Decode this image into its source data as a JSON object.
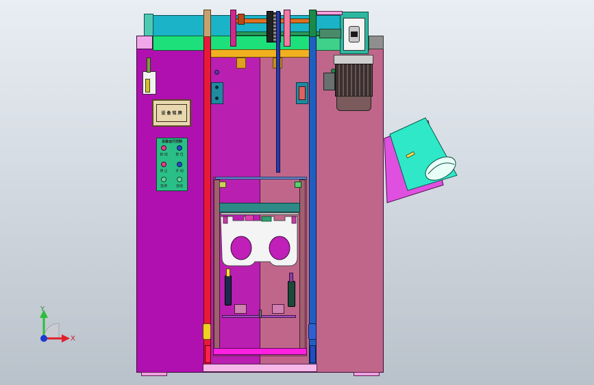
{
  "viewport": {
    "background_top": "#e9eef3",
    "background_bottom": "#b9c1ca"
  },
  "colors": {
    "body_magenta": "#b010b0",
    "body_pink": "#c0668a",
    "top_cyan": "#1ab3c7",
    "green_bar": "#1ee07a",
    "rail_red": "#e81a3a",
    "rail_blue": "#1f5fbf",
    "carriage_teal": "#2d8a86",
    "motor_dark": "#4a3b3b",
    "hopper_cyan": "#2ee8c8",
    "hopper_magenta": "#e050e0"
  },
  "control_panel": {
    "title": "设备运行控制",
    "left_labels": [
      "启 动",
      "停 止",
      "急停"
    ],
    "right_labels": [
      "复 位",
      "手 动",
      "自动"
    ]
  },
  "label_plate": {
    "text": "设 备 铭 牌"
  },
  "triad": {
    "x_label": "X",
    "y_label": "Y",
    "icon": "coordinate-triad-icon"
  }
}
